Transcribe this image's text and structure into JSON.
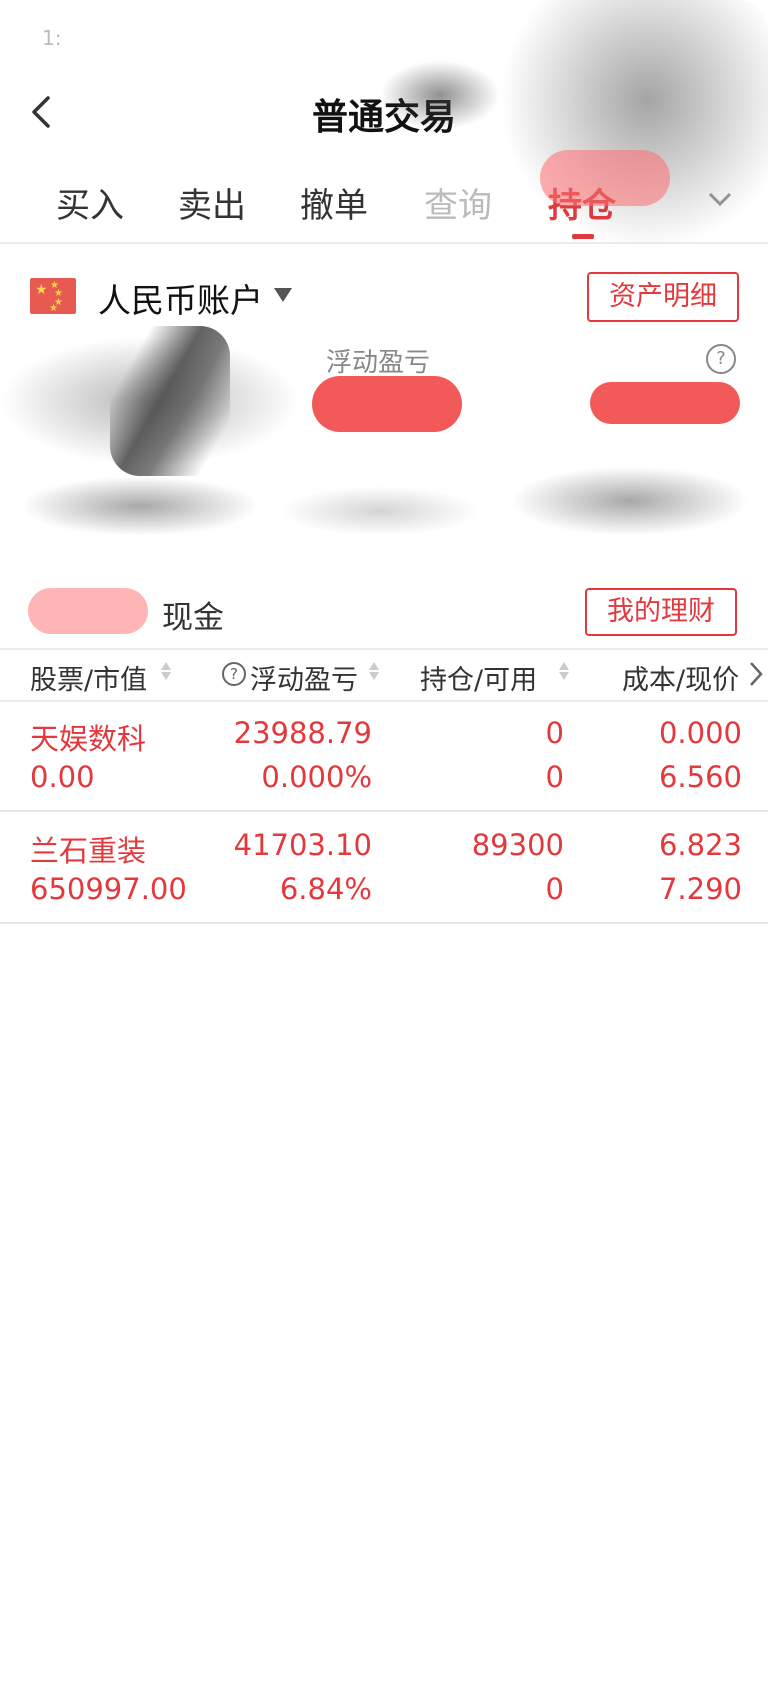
{
  "status_bar": {
    "time": "1:"
  },
  "nav": {
    "title": "普通交易"
  },
  "tabs": [
    {
      "label": "买入",
      "active": false
    },
    {
      "label": "卖出",
      "active": false
    },
    {
      "label": "撤单",
      "active": false
    },
    {
      "label": "查询",
      "active": false
    },
    {
      "label": "持仓",
      "active": true
    }
  ],
  "account": {
    "name": "人民币账户",
    "asset_detail_button": "资产明细"
  },
  "summary": {
    "floating_pl_label": "浮动盈亏"
  },
  "cash": {
    "label": "现金",
    "wealth_button": "我的理财"
  },
  "table": {
    "headers": [
      "股票/市值",
      "浮动盈亏",
      "持仓/可用",
      "成本/现价"
    ],
    "rows": [
      {
        "name": "天娱数科",
        "market_value": "0.00",
        "pl": "23988.79",
        "pl_pct": "0.000%",
        "position": "0",
        "available": "0",
        "cost": "0.000",
        "price": "6.560"
      },
      {
        "name": "兰石重装",
        "market_value": "650997.00",
        "pl": "41703.10",
        "pl_pct": "6.84%",
        "position": "89300",
        "available": "0",
        "cost": "6.823",
        "price": "7.290"
      }
    ]
  },
  "colors": {
    "accent": "#e4393c",
    "divider": "#ececec"
  }
}
